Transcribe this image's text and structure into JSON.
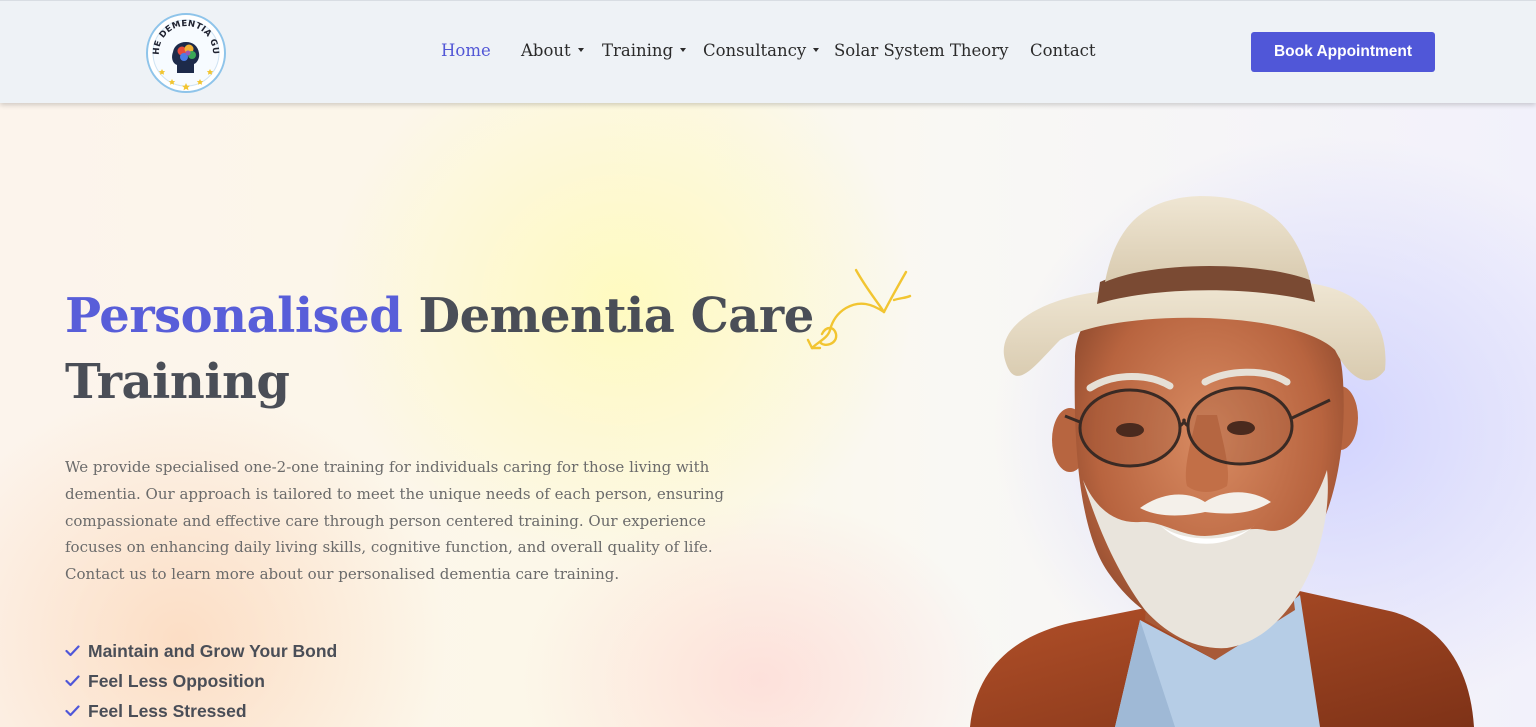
{
  "brand": {
    "logo_text": "THE DEMENTIA GUY"
  },
  "nav": {
    "items": [
      {
        "label": "Home",
        "active": true,
        "dropdown": false
      },
      {
        "label": "About",
        "active": false,
        "dropdown": true
      },
      {
        "label": "Training",
        "active": false,
        "dropdown": true
      },
      {
        "label": "Consultancy",
        "active": false,
        "dropdown": true
      },
      {
        "label": "Solar System Theory",
        "active": false,
        "dropdown": false
      },
      {
        "label": "Contact",
        "active": false,
        "dropdown": false
      }
    ],
    "cta_label": "Book Appointment"
  },
  "hero": {
    "headline_accent": "Personalised",
    "headline_rest": "Dementia Care",
    "headline_line2": "Training",
    "lead_lines": [
      "We provide specialised one-2-one training for individuals caring for those living with",
      "dementia. Our approach is tailored to meet the unique needs of each person, ensuring",
      "compassionate and effective care through person centered training. Our experience",
      "focuses on enhancing daily living skills, cognitive function, and overall quality of life.",
      "Contact us to learn more about our personalised dementia care training."
    ],
    "features": [
      "Maintain and Grow Your Bond",
      "Feel Less Opposition",
      "Feel Less Stressed"
    ]
  },
  "colors": {
    "accent": "#5057d8",
    "heading": "#4a4e57",
    "body_text": "#6b6b6b",
    "doodle": "#f2c531",
    "header_bg": "#eef2f6"
  },
  "icons": {
    "check": "check-icon",
    "caret": "caret-down-icon",
    "doodle": "arrow-doodle-icon"
  }
}
